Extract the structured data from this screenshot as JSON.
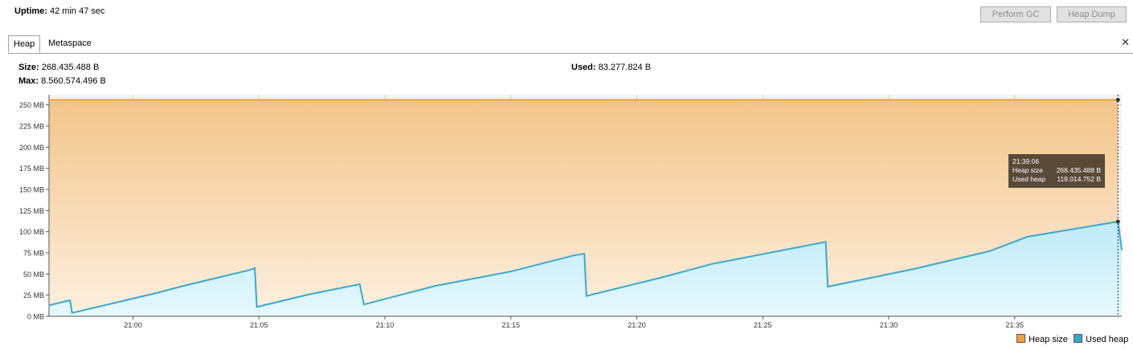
{
  "header": {
    "uptime_label": "Uptime:",
    "uptime_value": "42 min 47 sec",
    "perform_gc_label": "Perform GC",
    "heap_dump_label": "Heap Dump"
  },
  "tabs": [
    {
      "label": "Heap",
      "active": true
    },
    {
      "label": "Metaspace",
      "active": false
    }
  ],
  "close_glyph": "✕",
  "stats": {
    "size_label": "Size:",
    "size_value": "268.435.488 B",
    "max_label": "Max:",
    "max_value": "8.560.574.496 B",
    "used_label": "Used:",
    "used_value": "83.277.824 B"
  },
  "tooltip": {
    "time": "21:39:06",
    "rows": [
      {
        "label": "Heap size",
        "value": "268.435.488 B"
      },
      {
        "label": "Used heap",
        "value": "119.014.752 B"
      }
    ]
  },
  "colors": {
    "heap_size": "#f0a040",
    "used_heap": "#3aa9cc",
    "heap_fill_top": "#f2c48a",
    "used_fill": "#c9eef8",
    "tooltip_bg": "#5a4a3a"
  },
  "chart_data": {
    "type": "area",
    "xlim": [
      "20:56:40",
      "21:39:15"
    ],
    "ylim": [
      0,
      262
    ],
    "y_unit": "MB",
    "y_ticks": [
      0,
      25,
      50,
      75,
      100,
      125,
      150,
      175,
      200,
      225,
      250
    ],
    "y_tick_labels": [
      "0 MB",
      "25 MB",
      "50 MB",
      "75 MB",
      "100 MB",
      "125 MB",
      "150 MB",
      "175 MB",
      "200 MB",
      "225 MB",
      "250 MB"
    ],
    "x_ticks": [
      "21:00",
      "21:05",
      "21:10",
      "21:15",
      "21:20",
      "21:25",
      "21:30",
      "21:35"
    ],
    "grid": true,
    "legend_position": "bottom-right",
    "series": [
      {
        "name": "Heap size",
        "points": [
          [
            "20:56:40",
            256
          ],
          [
            "21:39:06",
            256
          ]
        ]
      },
      {
        "name": "Used heap",
        "points": [
          [
            "20:56:40",
            13
          ],
          [
            "20:57:30",
            19
          ],
          [
            "20:57:35",
            4
          ],
          [
            "21:00:00",
            21
          ],
          [
            "21:01:00",
            28
          ],
          [
            "21:02:00",
            36
          ],
          [
            "21:04:40",
            55
          ],
          [
            "21:04:50",
            57
          ],
          [
            "21:04:55",
            11
          ],
          [
            "21:07:00",
            26
          ],
          [
            "21:09:00",
            38
          ],
          [
            "21:09:10",
            14
          ],
          [
            "21:12:00",
            36
          ],
          [
            "21:15:00",
            53
          ],
          [
            "21:17:30",
            72
          ],
          [
            "21:17:55",
            74
          ],
          [
            "21:18:00",
            24
          ],
          [
            "21:21:00",
            46
          ],
          [
            "21:23:00",
            62
          ],
          [
            "21:27:30",
            88
          ],
          [
            "21:27:35",
            35
          ],
          [
            "21:31:00",
            56
          ],
          [
            "21:34:00",
            77
          ],
          [
            "21:35:30",
            94
          ],
          [
            "21:39:06",
            112
          ],
          [
            "21:39:15",
            78
          ]
        ]
      }
    ],
    "cursor_time": "21:39:06",
    "legend": [
      {
        "name": "Heap size",
        "color": "#f0a040"
      },
      {
        "name": "Used heap",
        "color": "#3aa9cc"
      }
    ]
  }
}
